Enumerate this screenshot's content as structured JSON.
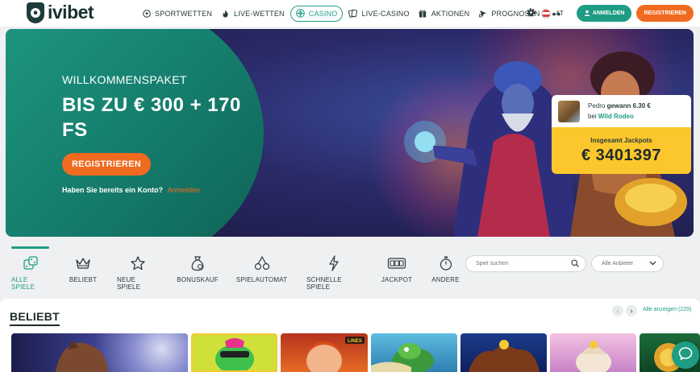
{
  "header": {
    "logo_text": "ivibet",
    "nav": [
      {
        "label": "SPORTWETTEN",
        "icon": "soccer-ball-icon"
      },
      {
        "label": "LIVE-WETTEN",
        "icon": "fire-icon"
      },
      {
        "label": "CASINO",
        "icon": "roulette-icon",
        "active": true
      },
      {
        "label": "LIVE-CASINO",
        "icon": "cards-icon"
      },
      {
        "label": "AKTIONEN",
        "icon": "gift-icon"
      },
      {
        "label": "PROGNOSEN",
        "icon": "cursor-icon"
      }
    ],
    "more": "•••",
    "lang": "AT",
    "login_label": "ANMELDEN",
    "register_label": "REGISTRIEREN"
  },
  "hero": {
    "subtitle": "WILLKOMMENSPAKET",
    "title": "BIS ZU € 300 + 170 FS",
    "button_label": "REGISTRIEREN",
    "login_question": "Haben Sie bereits ein Konto?",
    "login_link": "Anmelden"
  },
  "winner": {
    "name": "Pedro",
    "won_text": "gewann 6.30 €",
    "at": "bei",
    "game": "Wild Rodeo"
  },
  "jackpot": {
    "label": "Insgesamt Jackpots",
    "value": "€ 3401397"
  },
  "categories": [
    {
      "label": "ALLE SPIELE",
      "icon": "dice-icon",
      "active": true
    },
    {
      "label": "BELIEBT",
      "icon": "crown-icon"
    },
    {
      "label": "NEUE SPIELE",
      "icon": "star-icon"
    },
    {
      "label": "BONUSKAUF",
      "icon": "money-bag-icon"
    },
    {
      "label": "SPIELAUTOMAT",
      "icon": "cherries-icon"
    },
    {
      "label": "SCHNELLE SPIELE",
      "icon": "lightning-icon"
    },
    {
      "label": "JACKPOT",
      "icon": "slot-machine-icon"
    },
    {
      "label": "ANDERE",
      "icon": "stopwatch-icon"
    }
  ],
  "search": {
    "placeholder": "Spiel suchen"
  },
  "provider": {
    "selected": "Alle Anbieter"
  },
  "section": {
    "title": "BELIEBT",
    "show_all": "Alle anzeigen (229)"
  },
  "colors": {
    "brand_green": "#1f9c84",
    "accent_orange": "#f06a1f",
    "jackpot_yellow": "#fcc72c"
  }
}
